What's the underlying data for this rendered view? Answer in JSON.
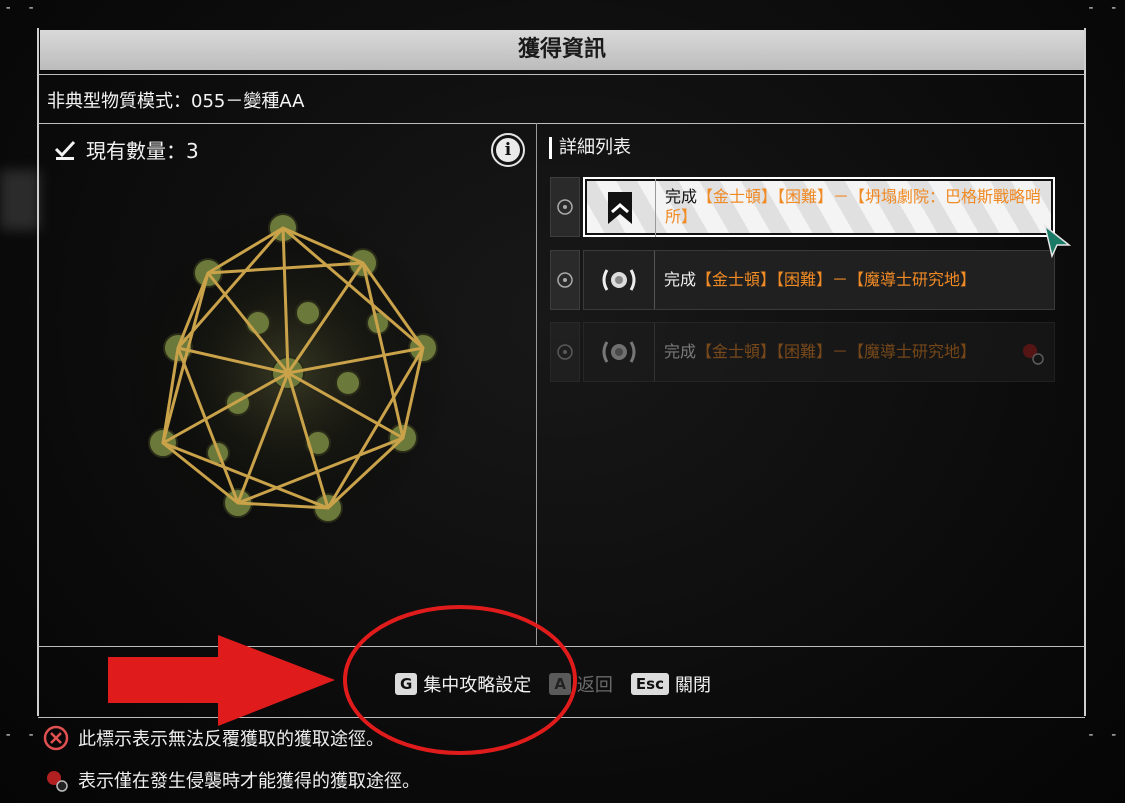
{
  "window": {
    "title": "獲得資訊",
    "subtitle": "非典型物質模式：055－變種AA"
  },
  "inventory": {
    "count_label": "現有數量：3"
  },
  "detail_list": {
    "title": "詳細列表",
    "rows": [
      {
        "prefix": "完成",
        "source": "【金士頓】【困難】－【坍塌劇院：巴格斯戰略哨所】",
        "icon": "rank-chevron-icon",
        "state": "selected"
      },
      {
        "prefix": "完成",
        "source": "【金士頓】【困難】－【魔導士研究地】",
        "icon": "broadcast-icon",
        "state": "normal"
      },
      {
        "prefix": "完成",
        "source": "【金士頓】【困難】－【魔導士研究地】",
        "icon": "broadcast-icon",
        "state": "disabled"
      }
    ]
  },
  "footer": {
    "keys": [
      {
        "key": "G",
        "label": "集中攻略設定"
      },
      {
        "key": "A",
        "label": "返回"
      },
      {
        "key": "Esc",
        "label": "關閉"
      }
    ]
  },
  "legend": [
    {
      "icon": "unrepeatable-icon",
      "text": "此標示表示無法反覆獲取的獲取途徑。"
    },
    {
      "icon": "invasion-icon",
      "text": "表示僅在發生侵襲時才能獲得的獲取途徑。"
    }
  ],
  "colors": {
    "accent_orange": "#f08a24",
    "annotation_red": "#e01b1b"
  }
}
